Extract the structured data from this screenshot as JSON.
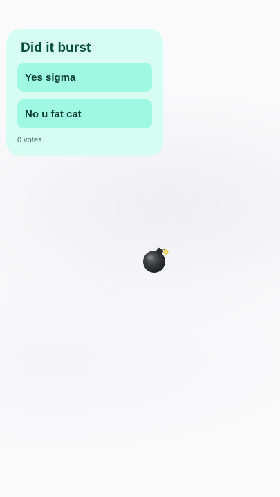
{
  "poll": {
    "title": "Did it burst",
    "options": [
      {
        "label": "Yes sigma"
      },
      {
        "label": "No u fat cat"
      }
    ],
    "votes": "0 votes"
  },
  "sticker": {
    "icon": "bomb-icon"
  }
}
